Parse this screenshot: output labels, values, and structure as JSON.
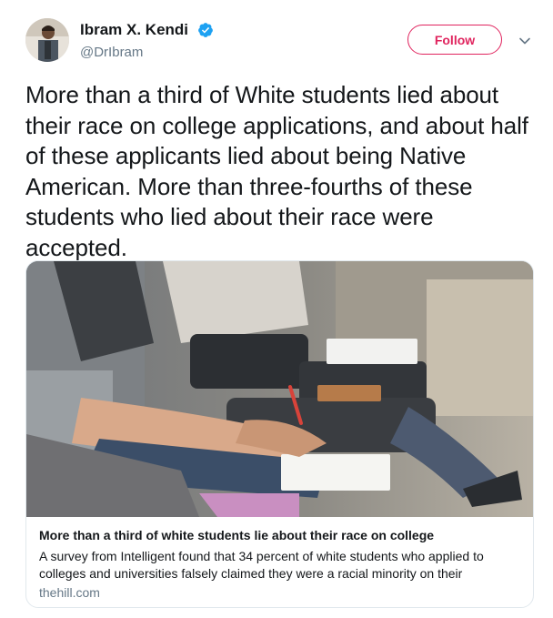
{
  "user": {
    "name": "Ibram X. Kendi",
    "handle": "@DrIbram",
    "verified": true
  },
  "actions": {
    "follow_label": "Follow"
  },
  "icons": {
    "verified": "verified-badge-icon",
    "more": "chevron-down-icon"
  },
  "colors": {
    "follow_accent": "#e0245e",
    "verified_blue": "#1da1f2",
    "secondary_text": "#657786"
  },
  "tweet": {
    "text": " More than a third of White students lied about their race on college applications, and about half of these applicants lied about being Native American. More than three-fourths of these students who lied about their race were accepted."
  },
  "card": {
    "title": "More than a third of white students lie about their race on college",
    "description": " A survey from Intelligent found that 34 percent of white students who applied to colleges and universities falsely claimed they were a racial minority on their",
    "domain": "thehill.com"
  }
}
